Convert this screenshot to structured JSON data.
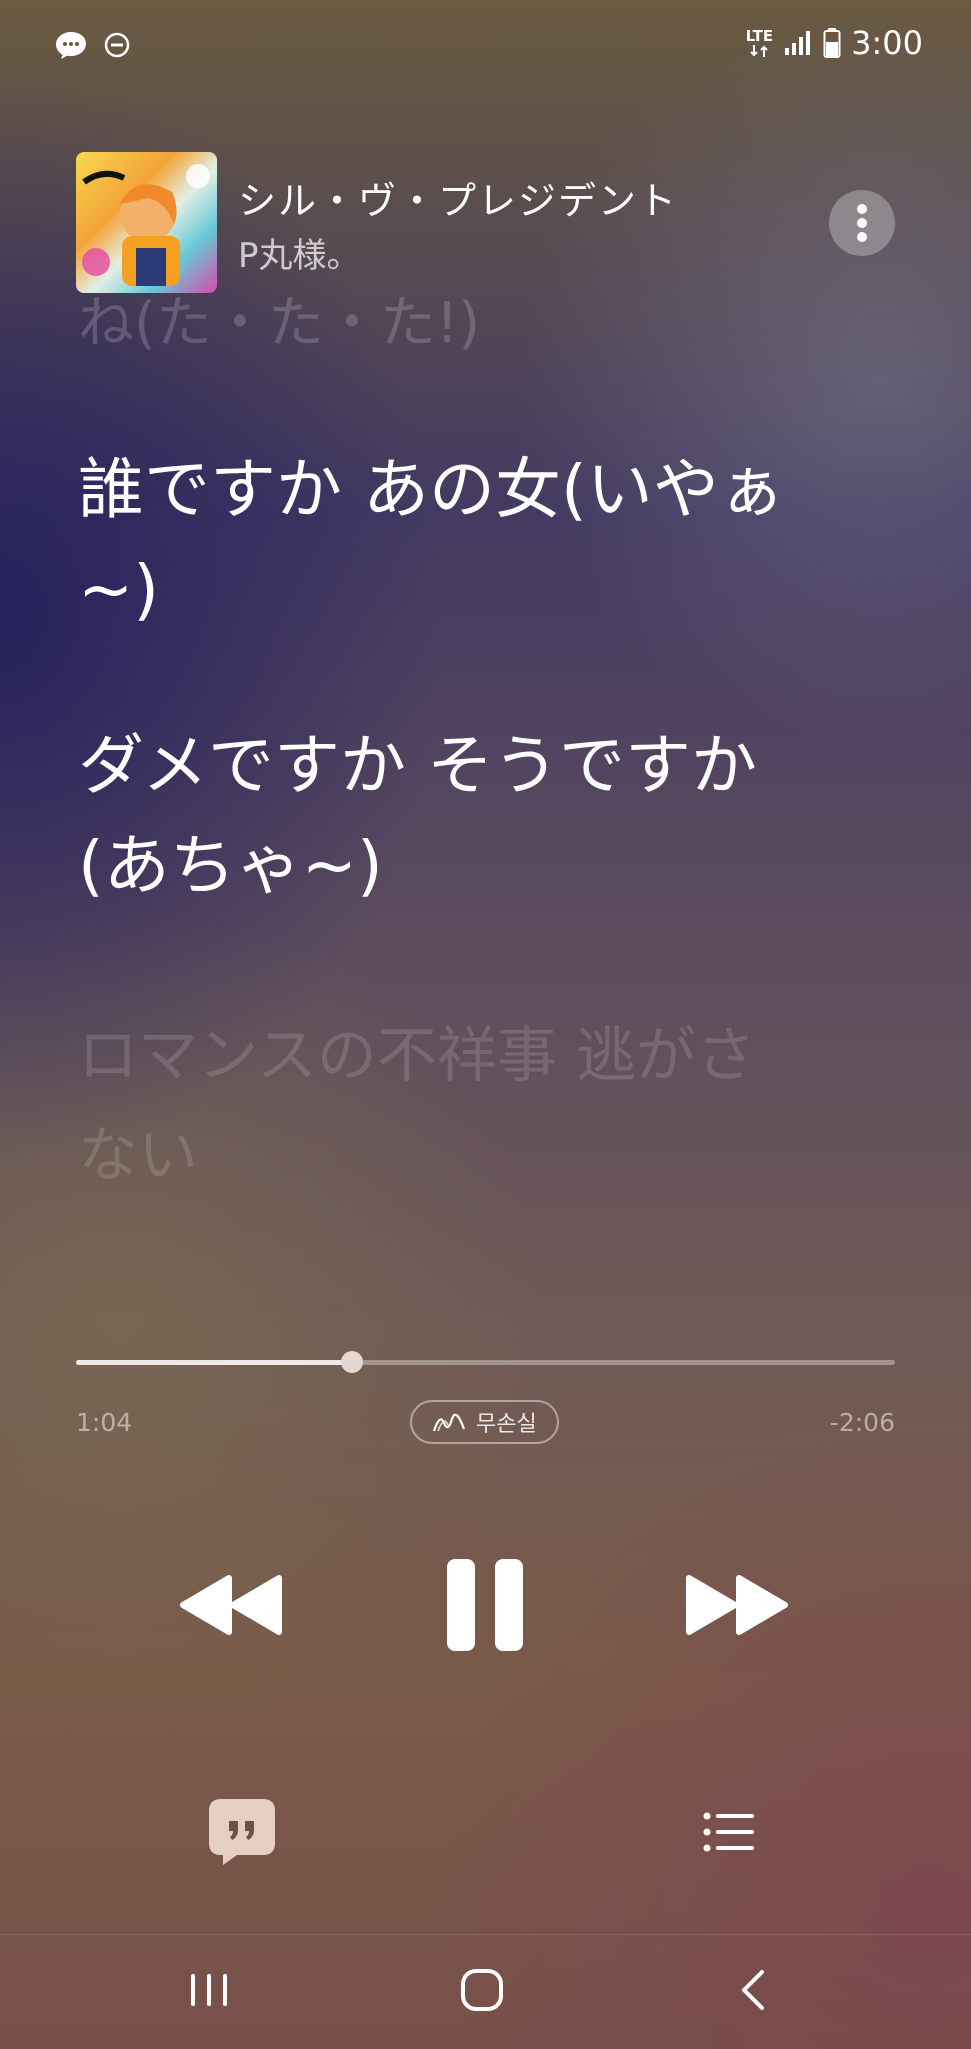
{
  "status_bar": {
    "time": "3:00",
    "network_label": "LTE",
    "left_icons": [
      "talk-notification-icon",
      "do-not-disturb-icon"
    ],
    "right_icons": [
      "lte-data-icon",
      "signal-icon",
      "battery-icon"
    ]
  },
  "now_playing": {
    "title": "シル・ヴ・プレジデント",
    "artist": "P丸様。"
  },
  "lyrics": {
    "previous": "ね(た・た・た!)",
    "current_1": "誰ですか あの女(いやぁ~)",
    "current_2": "ダメですか そうですか(あちゃ~)",
    "next": "ロマンスの不祥事 逃がさない"
  },
  "playback": {
    "elapsed": "1:04",
    "remaining": "-2:06",
    "progress_fraction": 0.337,
    "quality_label": "무손실"
  },
  "colors": {
    "accent_soft": "#e4d8d2",
    "icon_light": "#ffffff"
  }
}
